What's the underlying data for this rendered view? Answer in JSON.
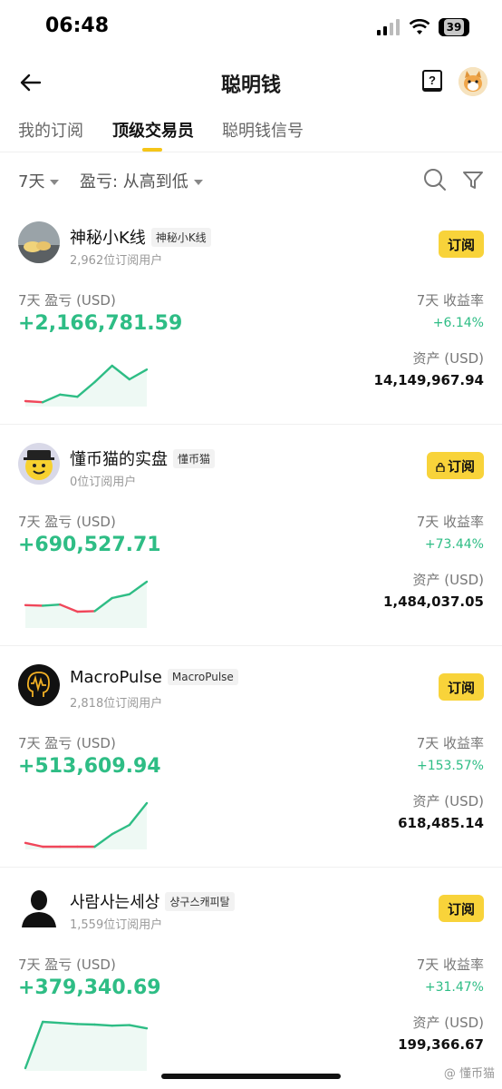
{
  "status": {
    "time": "06:48",
    "battery": "39"
  },
  "nav": {
    "title": "聪明钱"
  },
  "tabs": [
    {
      "label": "我的订阅"
    },
    {
      "label": "顶级交易员"
    },
    {
      "label": "聪明钱信号"
    }
  ],
  "filters": {
    "period": "7天",
    "sort": "盈亏: 从高到低"
  },
  "traders": [
    {
      "name": "神秘小K线",
      "tag": "神秘小K线",
      "subscribers": "2,962位订阅用户",
      "button": "订阅",
      "locked": false,
      "pnl_label": "7天 盈亏 (USD)",
      "pnl": "+2,166,781.59",
      "roi_label": "7天 收益率",
      "roi": "+6.14%",
      "asset_label": "资产 (USD)",
      "asset": "14,149,967.94",
      "spark": [
        0.1,
        0.08,
        0.22,
        0.18,
        0.45,
        0.75,
        0.5,
        0.68
      ]
    },
    {
      "name": "懂币猫的实盘",
      "tag": "懂币猫",
      "subscribers": "0位订阅用户",
      "button": "订阅",
      "locked": true,
      "pnl_label": "7天 盈亏 (USD)",
      "pnl": "+690,527.71",
      "roi_label": "7天 收益率",
      "roi": "+73.44%",
      "asset_label": "资产 (USD)",
      "asset": "1,484,037.05",
      "spark": [
        0.42,
        0.41,
        0.43,
        0.3,
        0.31,
        0.55,
        0.62,
        0.85
      ]
    },
    {
      "name": "MacroPulse",
      "tag": "MacroPulse",
      "subscribers": "2,818位订阅用户",
      "button": "订阅",
      "locked": false,
      "pnl_label": "7天 盈亏 (USD)",
      "pnl": "+513,609.94",
      "roi_label": "7天 收益率",
      "roi": "+153.57%",
      "asset_label": "资产 (USD)",
      "asset": "618,485.14",
      "spark": [
        0.12,
        0.05,
        0.05,
        0.05,
        0.05,
        0.28,
        0.45,
        0.85
      ]
    },
    {
      "name": "사람사는세상",
      "tag": "샹구스캐피탈",
      "subscribers": "1,559位订阅用户",
      "button": "订阅",
      "locked": false,
      "pnl_label": "7天 盈亏 (USD)",
      "pnl": "+379,340.69",
      "roi_label": "7天 收益率",
      "roi": "+31.47%",
      "asset_label": "资产 (USD)",
      "asset": "199,366.67",
      "spark": [
        0.05,
        0.9,
        0.88,
        0.86,
        0.85,
        0.83,
        0.84,
        0.78
      ]
    }
  ],
  "watermark": "@ 懂币猫",
  "colors": {
    "accent": "#f8d33a",
    "positive": "#2ebd85",
    "negative": "#f0475a"
  }
}
